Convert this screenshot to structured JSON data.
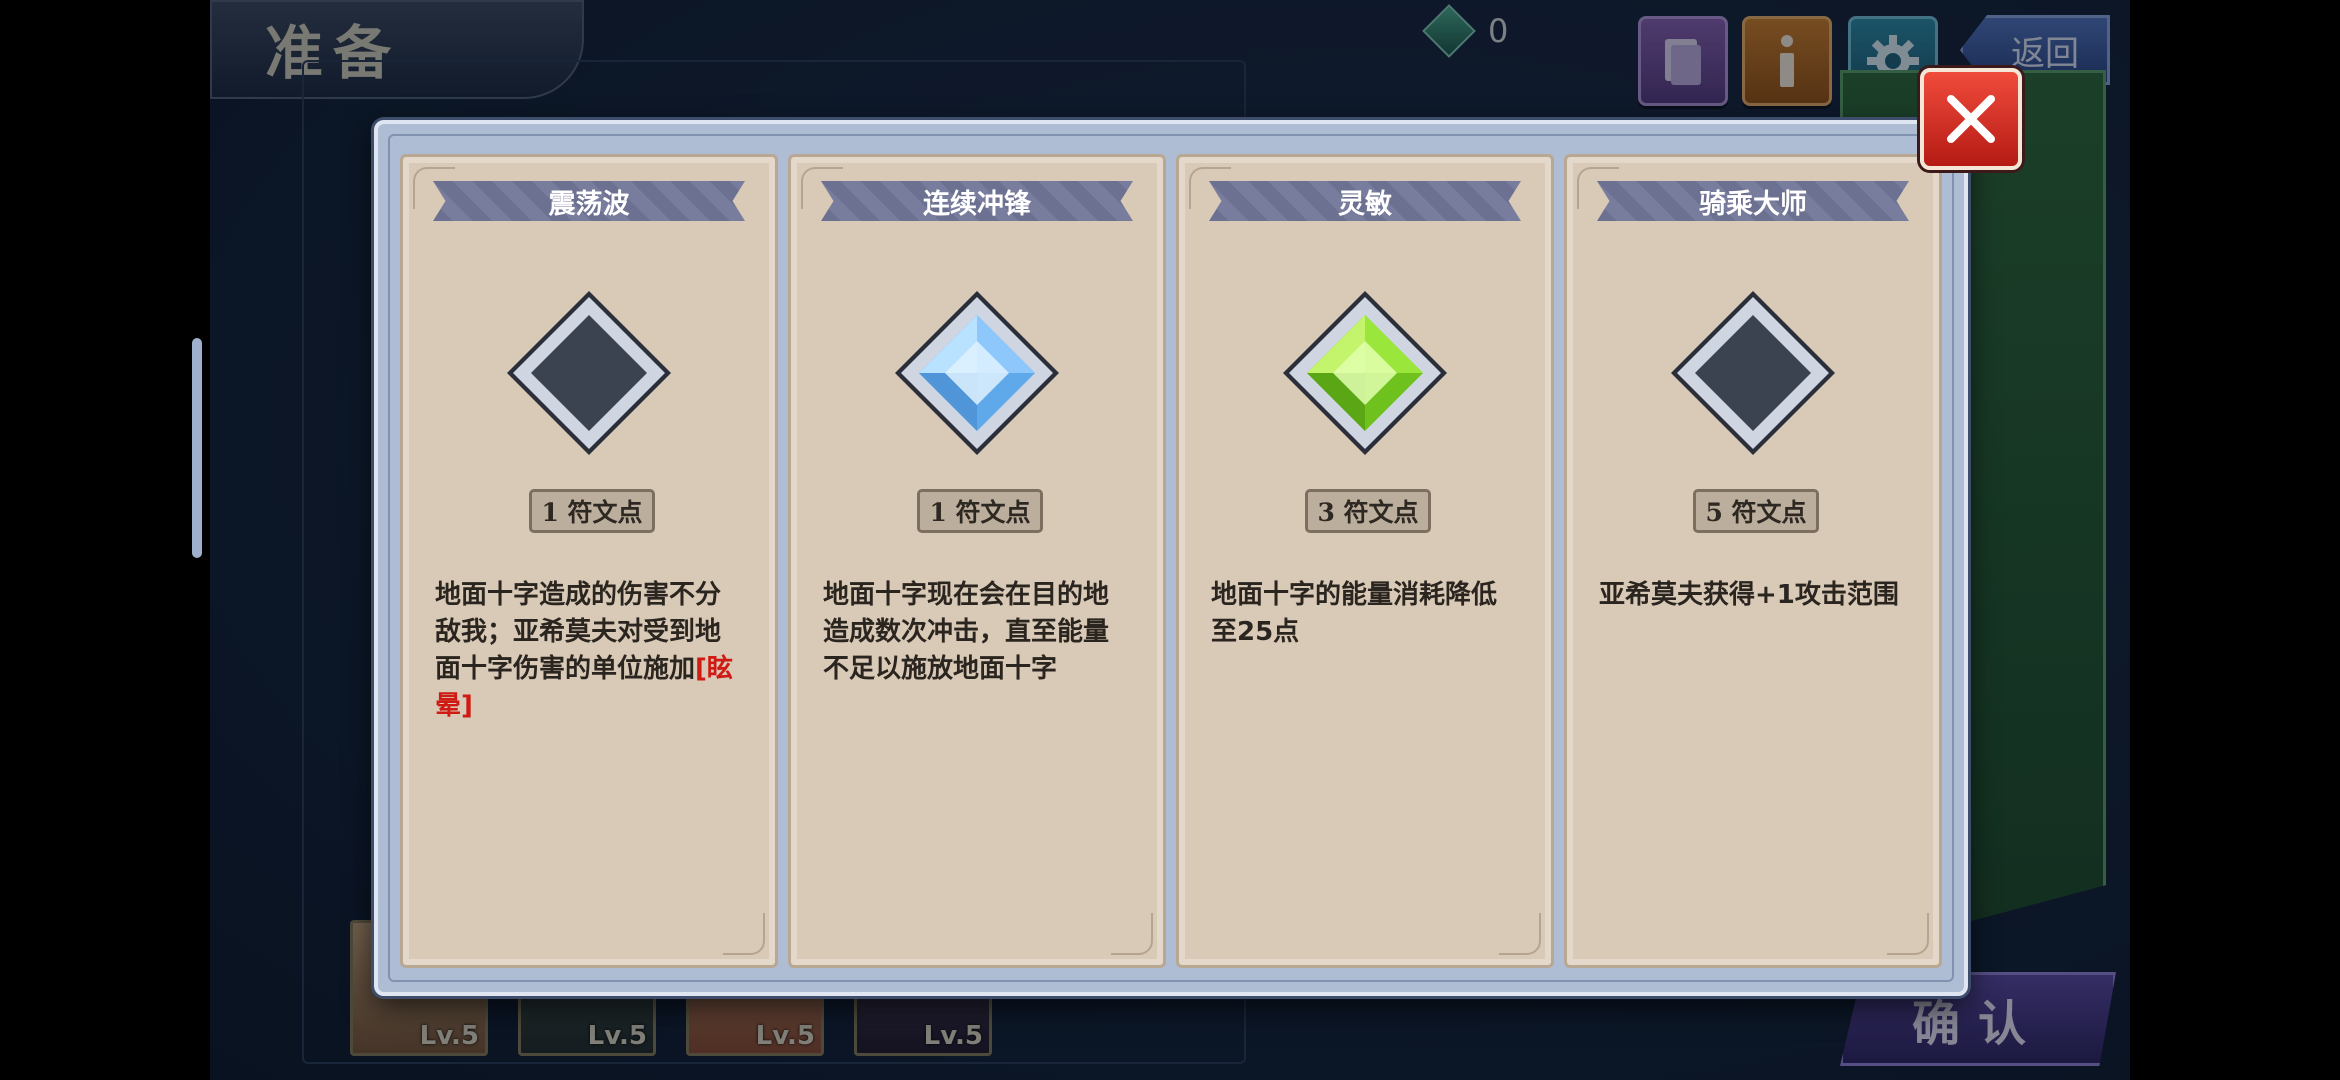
{
  "screen": {
    "title": "准备",
    "currency_count": "0",
    "back_label": "返回",
    "confirm_label": "确认"
  },
  "heroes": [
    {
      "level": "Lv.5"
    },
    {
      "level": "Lv.5"
    },
    {
      "level": "Lv.5"
    },
    {
      "level": "Lv.5"
    }
  ],
  "rune_cards": [
    {
      "title": "震荡波",
      "cost": "1 符文点",
      "gem_state": "empty",
      "desc_main": "地面十字造成的伤害不分敌我；亚希莫夫对受到地面十字伤害的单位施加",
      "desc_highlight": "[眩晕]"
    },
    {
      "title": "连续冲锋",
      "cost": "1 符文点",
      "gem_state": "blue",
      "desc_main": "地面十字现在会在目的地造成数次冲击，直至能量不足以施放地面十字",
      "desc_highlight": ""
    },
    {
      "title": "灵敏",
      "cost": "3 符文点",
      "gem_state": "green",
      "desc_main": "地面十字的能量消耗降低至25点",
      "desc_highlight": ""
    },
    {
      "title": "骑乘大师",
      "cost": "5 符文点",
      "gem_state": "empty",
      "desc_main": "亚希莫夫获得+1攻击范围",
      "desc_highlight": ""
    }
  ],
  "colors": {
    "highlight_text": "#d01a14",
    "gem_blue": "#9fd3ff",
    "gem_green": "#9be63a",
    "gem_empty": "#3b4350"
  }
}
